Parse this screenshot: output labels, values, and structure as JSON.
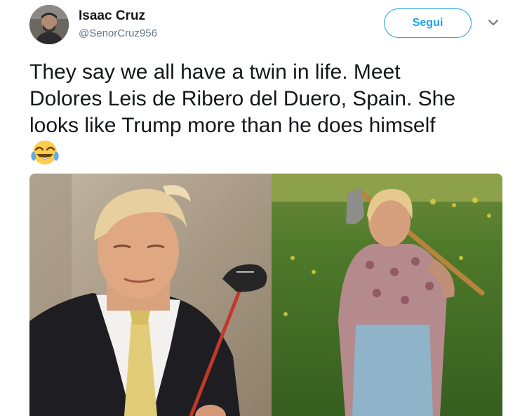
{
  "author": {
    "name": "Isaac Cruz",
    "handle": "@SenorCruz956"
  },
  "follow_button": {
    "label": "Segui"
  },
  "tweet": {
    "lines": [
      "They say we all have a twin in life. Meet",
      "Dolores Leis de Ribero del Duero, Spain. She",
      "looks like Trump more than he does himself"
    ],
    "emoji": "face-with-tears-of-joy"
  },
  "colors": {
    "accent": "#1da1f2",
    "text": "#14171a",
    "secondary_text": "#657786"
  },
  "icons": {
    "menu": "chevron-down-icon"
  }
}
